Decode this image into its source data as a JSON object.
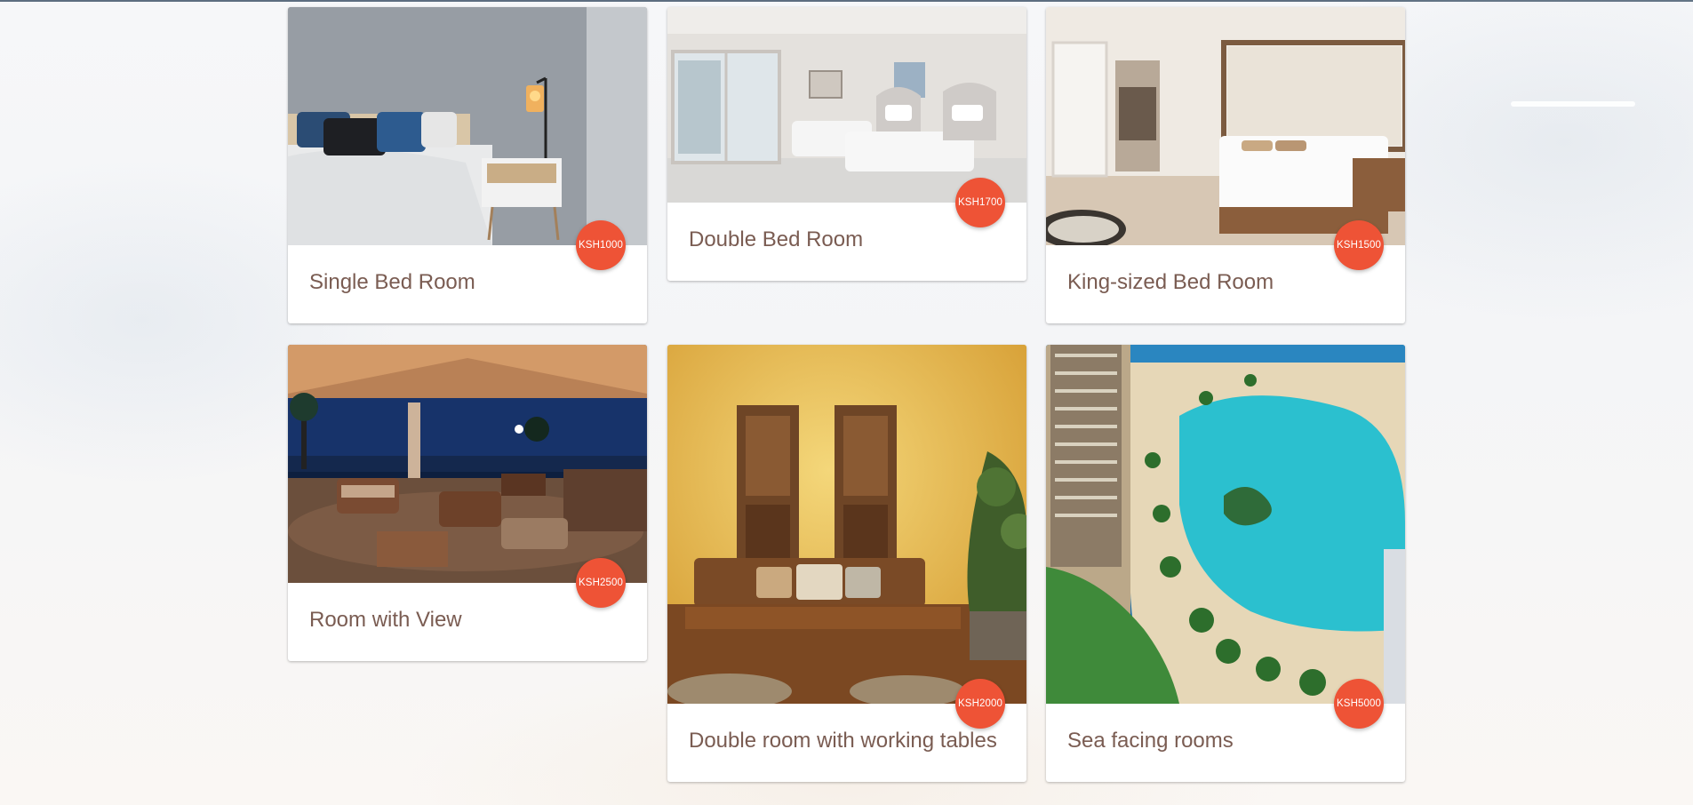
{
  "colors": {
    "price_badge": "#ee5336",
    "title_text": "#7a5c52",
    "card_bg": "#ffffff"
  },
  "rooms": [
    {
      "title": "Single Bed Room",
      "price": "KSH1000",
      "image": "single-bed-room-photo"
    },
    {
      "title": "Double Bed Room",
      "price": "KSH1700",
      "image": "double-bed-room-photo"
    },
    {
      "title": "King-sized Bed Room",
      "price": "KSH1500",
      "image": "king-sized-bed-room-photo"
    },
    {
      "title": "Room with View",
      "price": "KSH2500",
      "image": "night-patio-view-photo"
    },
    {
      "title": "Double room with working tables",
      "price": "KSH2000",
      "image": "yellow-room-wooden-panels-photo"
    },
    {
      "title": "Sea facing rooms",
      "price": "KSH5000",
      "image": "beach-lagoon-aerial-photo"
    }
  ]
}
